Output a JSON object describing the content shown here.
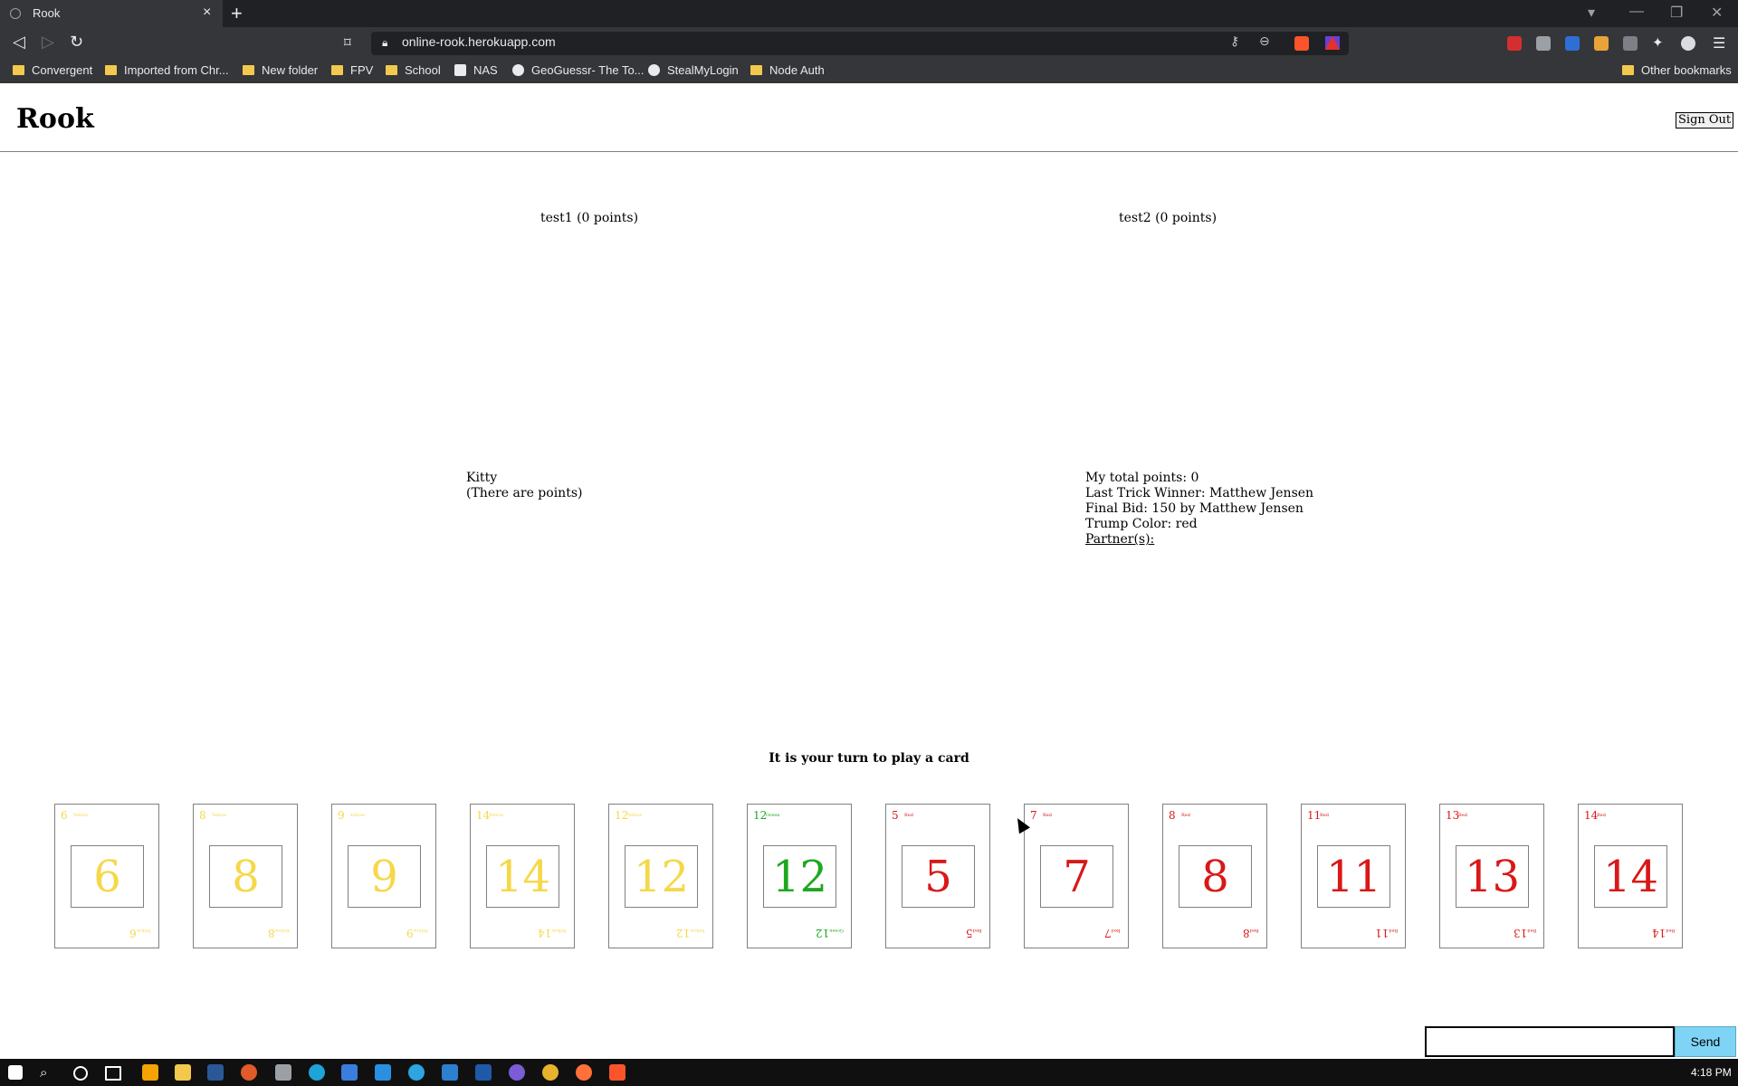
{
  "browser": {
    "tab_title": "Rook",
    "url": "online-rook.herokuapp.com",
    "bookmarks": [
      {
        "label": "Convergent",
        "icon": "folder-icon"
      },
      {
        "label": "Imported from Chr...",
        "icon": "folder-icon"
      },
      {
        "label": "New folder",
        "icon": "folder-icon"
      },
      {
        "label": "FPV",
        "icon": "folder-icon"
      },
      {
        "label": "School",
        "icon": "folder-icon"
      },
      {
        "label": "NAS",
        "icon": "synology-icon"
      },
      {
        "label": "GeoGuessr- The To...",
        "icon": "wordpress-icon"
      },
      {
        "label": "StealMyLogin",
        "icon": "globe-icon"
      },
      {
        "label": "Node Auth",
        "icon": "folder-icon"
      }
    ],
    "other_bookmarks": "Other bookmarks"
  },
  "app": {
    "title": "Rook",
    "sign_out": "Sign Out"
  },
  "players": {
    "left": "test1 (0 points)",
    "right": "test2 (0 points)"
  },
  "kitty": {
    "label": "Kitty",
    "note": "(There are points)"
  },
  "info": {
    "total_points": "My total points: 0",
    "last_trick_winner": "Last Trick Winner: Matthew Jensen",
    "final_bid": "Final Bid: 150 by Matthew Jensen",
    "trump_color": "Trump Color: red",
    "partners": "Partner(s):"
  },
  "turn_message": "It is your turn to play a card",
  "hand": [
    {
      "num": "6",
      "color": "Yellow"
    },
    {
      "num": "8",
      "color": "Yellow"
    },
    {
      "num": "9",
      "color": "Yellow"
    },
    {
      "num": "14",
      "color": "Yellow"
    },
    {
      "num": "12",
      "color": "Yellow"
    },
    {
      "num": "12",
      "color": "Green"
    },
    {
      "num": "5",
      "color": "Red"
    },
    {
      "num": "7",
      "color": "Red"
    },
    {
      "num": "8",
      "color": "Red"
    },
    {
      "num": "11",
      "color": "Red"
    },
    {
      "num": "13",
      "color": "Red"
    },
    {
      "num": "14",
      "color": "Red"
    }
  ],
  "card_colors": {
    "Yellow": "#f5d84a",
    "Green": "#1fa81f",
    "Red": "#d91818"
  },
  "chat": {
    "input_value": "",
    "send_label": "Send"
  },
  "taskbar": {
    "time": "4:18 PM"
  }
}
